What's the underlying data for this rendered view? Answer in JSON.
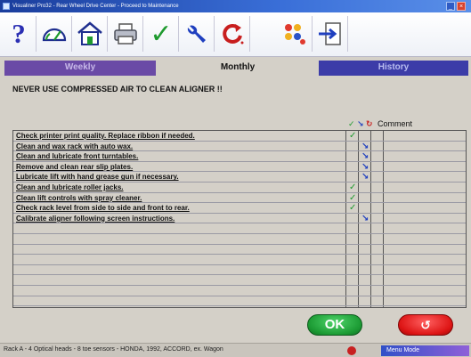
{
  "window": {
    "title": "Visualiner Pro32 - Rear Wheel Drive Center - Proceed to Maintenance"
  },
  "toolbar": {
    "help_label": "?",
    "icons": [
      "help-icon",
      "gauge-icon",
      "home-icon",
      "printer-icon",
      "checkmark-icon",
      "wrench-icon",
      "refresh-icon",
      "settings-grid-icon",
      "exit-icon"
    ]
  },
  "tabs": [
    {
      "label": "Weekly"
    },
    {
      "label": "Monthly"
    },
    {
      "label": "History"
    }
  ],
  "notice": "NEVER USE COMPRESSED AIR TO CLEAN ALIGNER !!",
  "columns": {
    "done_glyph": "✓",
    "adjust_glyph": "↘",
    "repair_glyph": "↻",
    "comment": "Comment"
  },
  "tasks": [
    {
      "text": "Check printer print quality.  Replace ribbon if needed.",
      "mark": "done",
      "glyph": "✓"
    },
    {
      "text": "Clean and wax rack with auto wax.",
      "mark": "adj",
      "glyph": "↘"
    },
    {
      "text": "Clean and lubricate front turntables.",
      "mark": "adj",
      "glyph": "↘"
    },
    {
      "text": "Remove and clean rear slip plates.",
      "mark": "adj",
      "glyph": "↘"
    },
    {
      "text": "Lubricate lift with hand grease gun if necessary.",
      "mark": "adj",
      "glyph": "↘"
    },
    {
      "text": "Clean and lubricate roller jacks.",
      "mark": "done",
      "glyph": "✓"
    },
    {
      "text": "Clean lift controls with spray cleaner.",
      "mark": "done",
      "glyph": "✓"
    },
    {
      "text": "Check rack level from side to side and front to rear.",
      "mark": "done",
      "glyph": "✓"
    },
    {
      "text": "Calibrate aligner following screen instructions.",
      "mark": "adj",
      "glyph": "↘"
    }
  ],
  "buttons": {
    "ok": "OK",
    "cancel_glyph": "↺"
  },
  "status": {
    "text": "Rack A - 4 Optical heads - 8 toe sensors - HONDA, 1992, ACCORD, ex. Wagon",
    "mode": "Menu Mode"
  }
}
